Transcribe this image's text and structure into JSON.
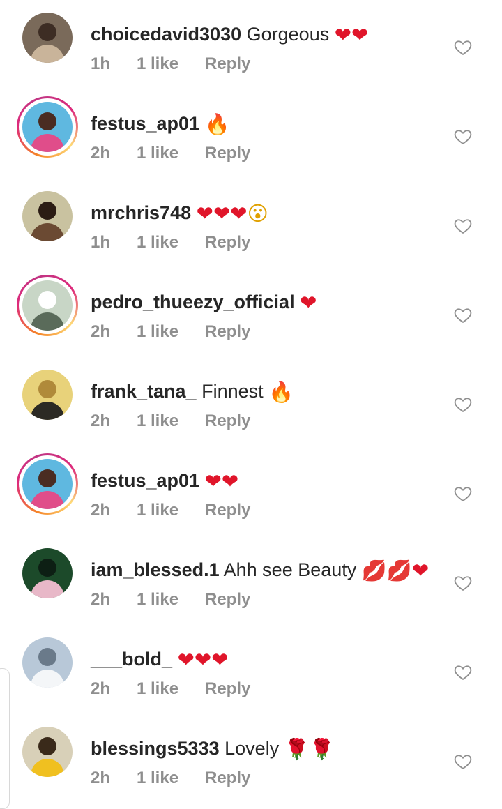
{
  "comments": [
    {
      "username": "choicedavid3030",
      "text": "Gorgeous",
      "emojis": [
        {
          "kind": "heart",
          "glyph": "❤"
        },
        {
          "kind": "heart",
          "glyph": "❤"
        }
      ],
      "time": "1h",
      "likes": "1 like",
      "reply": "Reply",
      "ring": false,
      "avatar_colors": [
        "#7a6a5a",
        "#c9b49a",
        "#3d2d24"
      ]
    },
    {
      "username": "festus_ap01",
      "text": "",
      "emojis": [
        {
          "kind": "fire",
          "glyph": "🔥"
        }
      ],
      "time": "2h",
      "likes": "1 like",
      "reply": "Reply",
      "ring": true,
      "avatar_colors": [
        "#5fb8e0",
        "#e04d8a",
        "#4a2c22"
      ]
    },
    {
      "username": "mrchris748",
      "text": "",
      "emojis": [
        {
          "kind": "heart",
          "glyph": "❤"
        },
        {
          "kind": "heart",
          "glyph": "❤"
        },
        {
          "kind": "heart",
          "glyph": "❤"
        },
        {
          "kind": "wow",
          "glyph": "😮"
        }
      ],
      "time": "1h",
      "likes": "1 like",
      "reply": "Reply",
      "ring": false,
      "avatar_colors": [
        "#c9c2a0",
        "#6b4a33",
        "#2b1c14"
      ]
    },
    {
      "username": "pedro_thueezy_official",
      "text": "",
      "emojis": [
        {
          "kind": "heart",
          "glyph": "❤"
        }
      ],
      "time": "2h",
      "likes": "1 like",
      "reply": "Reply",
      "ring": true,
      "avatar_colors": [
        "#c8d6c6",
        "#5a6b5a",
        "#ffffff"
      ]
    },
    {
      "username": "frank_tana_",
      "text": "Finnest",
      "emojis": [
        {
          "kind": "fire",
          "glyph": "🔥"
        }
      ],
      "time": "2h",
      "likes": "1 like",
      "reply": "Reply",
      "ring": false,
      "avatar_colors": [
        "#e8d27a",
        "#2c2a24",
        "#b08a3a"
      ]
    },
    {
      "username": "festus_ap01",
      "text": "",
      "emojis": [
        {
          "kind": "heart",
          "glyph": "❤"
        },
        {
          "kind": "heart",
          "glyph": "❤"
        }
      ],
      "time": "2h",
      "likes": "1 like",
      "reply": "Reply",
      "ring": true,
      "avatar_colors": [
        "#5fb8e0",
        "#e04d8a",
        "#4a2c22"
      ]
    },
    {
      "username": "iam_blessed.1",
      "text": "Ahh see Beauty",
      "emojis": [
        {
          "kind": "kiss",
          "glyph": "💋"
        },
        {
          "kind": "kiss",
          "glyph": "💋"
        },
        {
          "kind": "heart",
          "glyph": "❤"
        }
      ],
      "time": "2h",
      "likes": "1 like",
      "reply": "Reply",
      "ring": false,
      "avatar_colors": [
        "#1c4a2a",
        "#e8b8c8",
        "#0d1f14"
      ]
    },
    {
      "username": "___bold_",
      "text": "",
      "emojis": [
        {
          "kind": "heart",
          "glyph": "❤"
        },
        {
          "kind": "heart",
          "glyph": "❤"
        },
        {
          "kind": "heart",
          "glyph": "❤"
        }
      ],
      "time": "2h",
      "likes": "1 like",
      "reply": "Reply",
      "ring": false,
      "avatar_colors": [
        "#b8c8d8",
        "#f4f6f8",
        "#6a7a8a"
      ]
    },
    {
      "username": "blessings5333",
      "text": "Lovely",
      "emojis": [
        {
          "kind": "rose",
          "glyph": "🌹"
        },
        {
          "kind": "rose",
          "glyph": "🌹"
        }
      ],
      "time": "2h",
      "likes": "1 like",
      "reply": "Reply",
      "ring": false,
      "avatar_colors": [
        "#d8d0b8",
        "#f0c020",
        "#3a2a1a"
      ]
    }
  ],
  "icons": {
    "like": "heart-outline-icon"
  },
  "colors": {
    "username": "#262626",
    "meta": "#8e8e8e",
    "heart": "#e0152a",
    "like_icon": "#8e8e8e"
  }
}
